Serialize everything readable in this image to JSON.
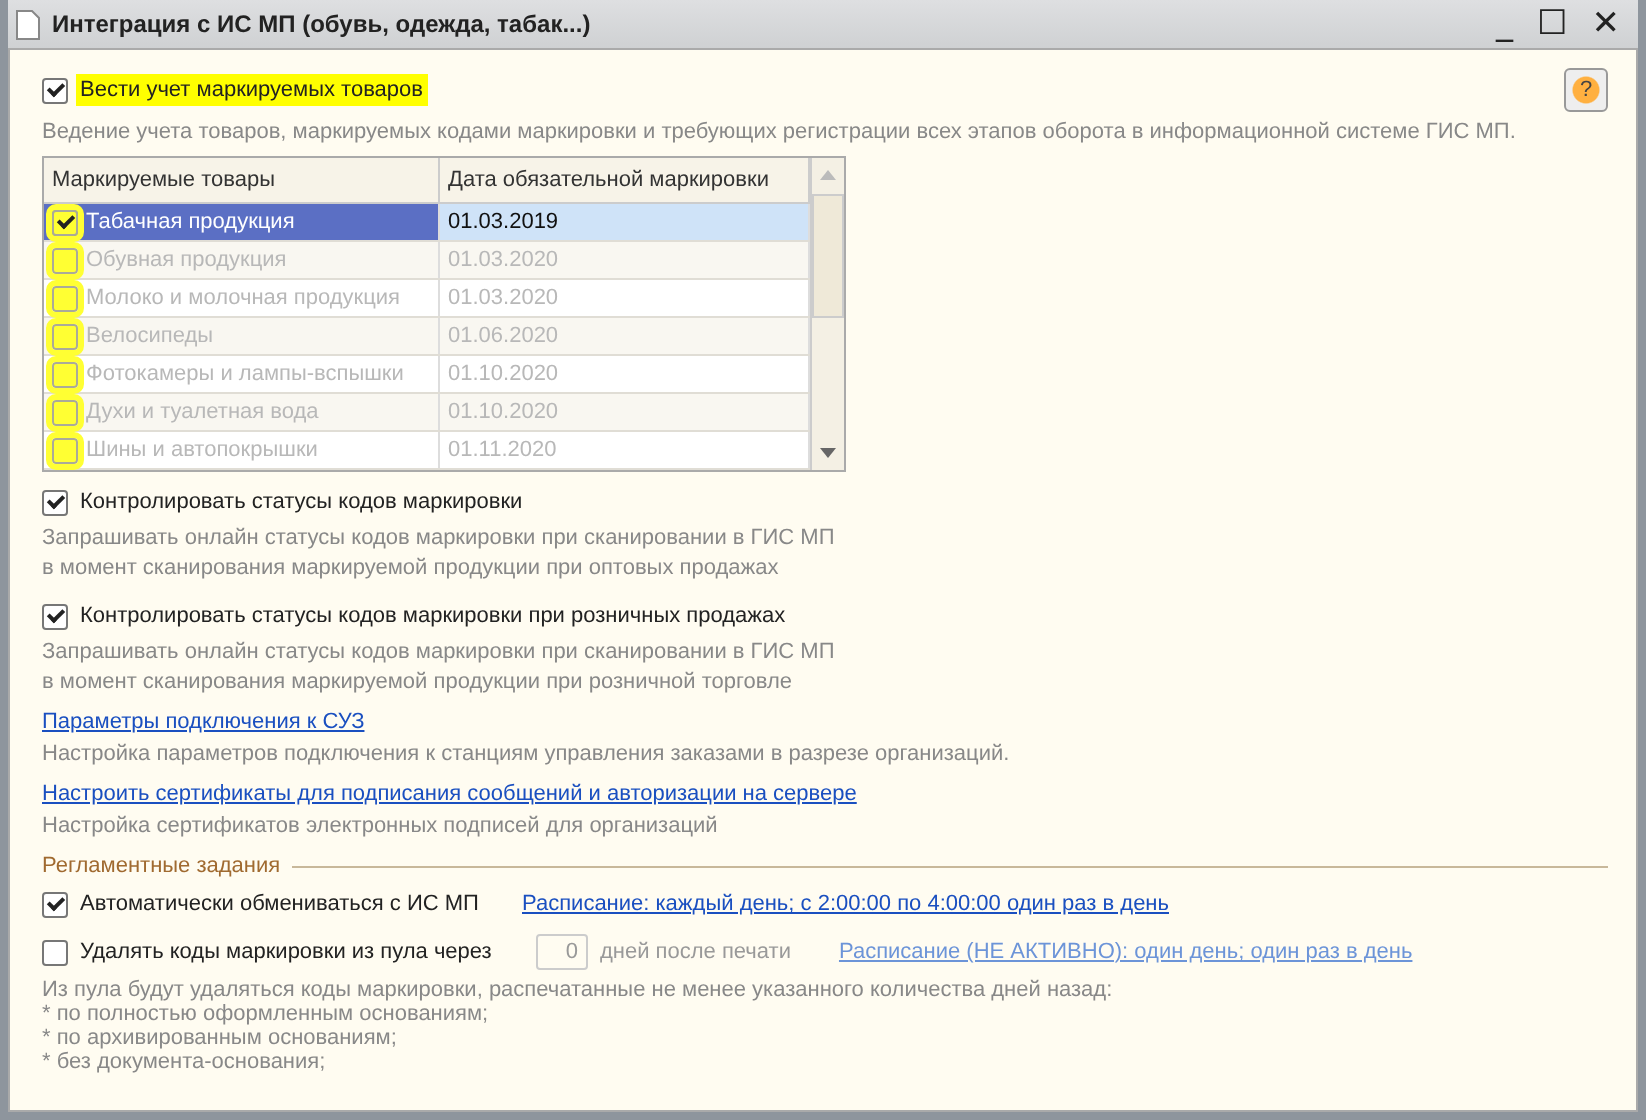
{
  "window": {
    "title": "Интеграция с ИС МП (обувь, одежда, табак...)",
    "controls": [
      "_",
      "☐",
      "✕"
    ]
  },
  "main_option": {
    "label": "Вести учет маркируемых товаров",
    "checked": true,
    "highlighted": true,
    "description": "Ведение учета товаров, маркируемых кодами маркировки и требующих регистрации всех этапов оборота в информационной системе ГИС МП."
  },
  "help_button": {
    "label": "?"
  },
  "table": {
    "highlighted": true,
    "columns": [
      "Маркируемые товары",
      "Дата обязательной маркировки"
    ],
    "rows": [
      {
        "name": "Табачная продукция",
        "date": "01.03.2019",
        "checked": true,
        "selected": true,
        "disabled": false
      },
      {
        "name": "Обувная продукция",
        "date": "01.03.2020",
        "checked": false,
        "selected": false,
        "disabled": true
      },
      {
        "name": "Молоко и молочная продукция",
        "date": "01.03.2020",
        "checked": false,
        "selected": false,
        "disabled": true
      },
      {
        "name": "Велосипеды",
        "date": "01.06.2020",
        "checked": false,
        "selected": false,
        "disabled": true
      },
      {
        "name": "Фотокамеры и лампы-вспышки",
        "date": "01.10.2020",
        "checked": false,
        "selected": false,
        "disabled": true
      },
      {
        "name": "Духи и туалетная вода",
        "date": "01.10.2020",
        "checked": false,
        "selected": false,
        "disabled": true
      },
      {
        "name": "Шины и автопокрышки",
        "date": "01.11.2020",
        "checked": false,
        "selected": false,
        "disabled": true
      }
    ]
  },
  "options": [
    {
      "kind": "checkbox",
      "label": "Контролировать статусы кодов маркировки",
      "checked": true,
      "description": [
        "Запрашивать онлайн статусы кодов маркировки при сканировании в ГИС МП",
        "в момент сканирования маркируемой продукции при оптовых продажах"
      ]
    },
    {
      "kind": "checkbox",
      "label": "Контролировать статусы кодов маркировки при розничных продажах",
      "checked": true,
      "description": [
        "Запрашивать онлайн статусы кодов маркировки при сканировании в ГИС МП",
        "в момент сканирования маркируемой продукции при розничной торговле"
      ]
    },
    {
      "kind": "link",
      "label": "Параметры подключения к СУЗ",
      "description": [
        "Настройка параметров подключения к станциям управления заказами в разрезе организаций."
      ]
    },
    {
      "kind": "link",
      "label": "Настроить сертификаты для подписания сообщений и авторизации на сервере",
      "description": [
        "Настройка сертификатов электронных подписей для организаций"
      ]
    }
  ],
  "scheduled": {
    "title": "Регламентные задания",
    "auto_exchange": {
      "label": "Автоматически обмениваться с ИС МП",
      "checked": true,
      "schedule": "Расписание: каждый день; с 2:00:00 по 4:00:00 один раз в день",
      "schedule_disabled": false
    },
    "delete_codes": {
      "label": "Удалять коды маркировки из пула через",
      "checked": false,
      "days": "0",
      "days_label": "дней после печати",
      "schedule": "Расписание (НЕ АКТИВНО): один день; один раз в день",
      "schedule_disabled": true
    },
    "notes": [
      "Из пула будут удаляться коды маркировки, распечатанные не менее указанного количества дней назад:",
      "* по полностью оформленным основаниям;",
      "* по архивированным основаниям;",
      "* без документа-основания;"
    ]
  }
}
